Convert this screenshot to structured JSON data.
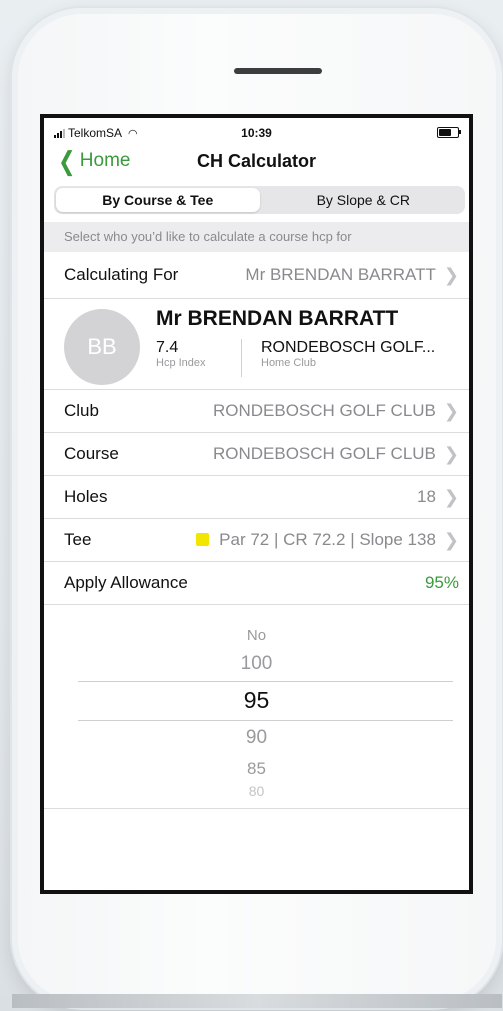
{
  "status": {
    "carrier": "TelkomSA",
    "time": "10:39"
  },
  "nav": {
    "back_label": "Home",
    "title": "CH Calculator"
  },
  "segment": {
    "option1": "By Course & Tee",
    "option2": "By Slope & CR"
  },
  "hint": "Select who you’d like to calculate a course hcp for",
  "calculating_for": {
    "label": "Calculating For",
    "value": "Mr BRENDAN BARRATT"
  },
  "profile": {
    "initials": "BB",
    "name": "Mr BRENDAN BARRATT",
    "hcp_value": "7.4",
    "hcp_label": "Hcp Index",
    "club_value": "RONDEBOSCH GOLF...",
    "club_label": "Home Club"
  },
  "rows": {
    "club": {
      "label": "Club",
      "value": "RONDEBOSCH GOLF CLUB"
    },
    "course": {
      "label": "Course",
      "value": "RONDEBOSCH GOLF CLUB"
    },
    "holes": {
      "label": "Holes",
      "value": "18"
    },
    "tee": {
      "label": "Tee",
      "value": "Par 72 | CR 72.2 | Slope 138",
      "color": "#f2e600"
    },
    "allowance": {
      "label": "Apply Allowance",
      "value": "95%"
    }
  },
  "picker": {
    "options": [
      "No",
      "100",
      "95",
      "90",
      "85",
      "80"
    ],
    "selected": "95"
  },
  "colors": {
    "accent": "#3a9a3c"
  }
}
